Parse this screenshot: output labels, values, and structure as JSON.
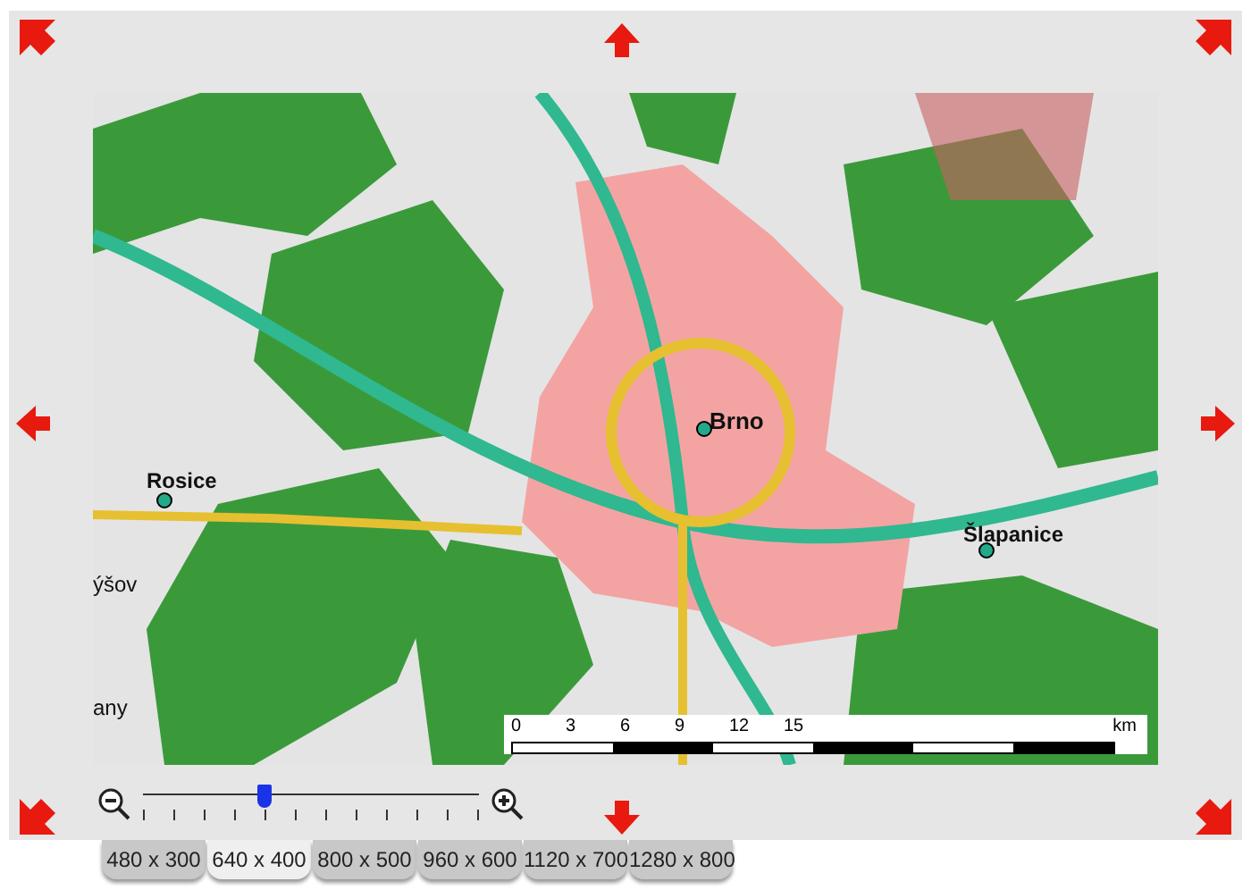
{
  "map": {
    "places": [
      {
        "name": "Brno",
        "kind": "city"
      },
      {
        "name": "Rosice",
        "kind": "town"
      },
      {
        "name": "Šlapanice",
        "kind": "town"
      },
      {
        "name": "ýšov",
        "kind": "cut"
      },
      {
        "name": "any",
        "kind": "cut"
      }
    ],
    "scale_bar": {
      "ticks": [
        "0",
        "3",
        "6",
        "9",
        "12",
        "15"
      ],
      "unit": "km"
    }
  },
  "zoom": {
    "level": 0.36
  },
  "tabs": [
    {
      "label": "480 x 300",
      "selected": false
    },
    {
      "label": "640 x 400",
      "selected": true
    },
    {
      "label": "800 x 500",
      "selected": false
    },
    {
      "label": "960 x 600",
      "selected": false
    },
    {
      "label": "1120 x 700",
      "selected": false
    },
    {
      "label": "1280 x 800",
      "selected": false
    }
  ]
}
